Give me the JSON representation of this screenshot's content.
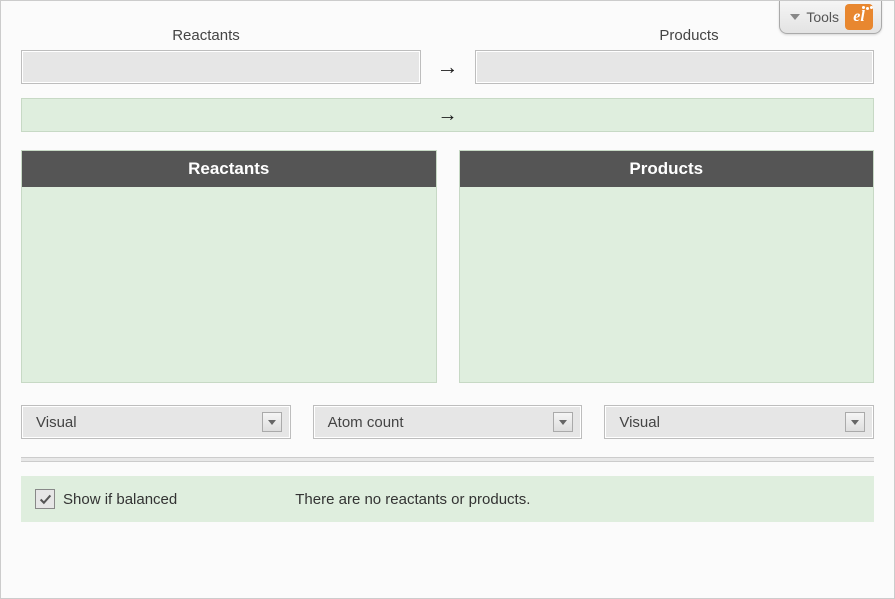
{
  "tools": {
    "label": "Tools",
    "badge": "el"
  },
  "top_labels": {
    "reactants": "Reactants",
    "products": "Products"
  },
  "panels": {
    "reactants_header": "Reactants",
    "products_header": "Products"
  },
  "dropdowns": {
    "visual_left": "Visual",
    "atom_count": "Atom count",
    "visual_right": "Visual"
  },
  "status": {
    "checkbox_label": "Show if balanced",
    "message": "There are no reactants or products."
  },
  "arrows": {
    "right_arrow": "→"
  }
}
